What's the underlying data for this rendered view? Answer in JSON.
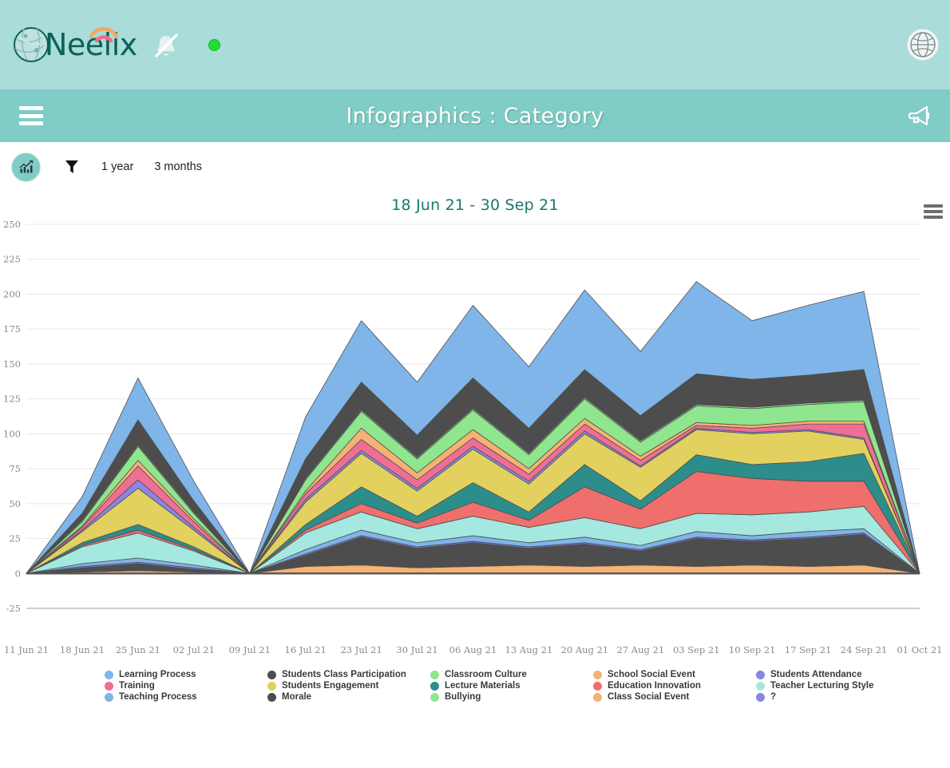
{
  "brand": {
    "name": "Neelix",
    "logo_icon": "globe-icon",
    "wifi_icon": "wifi-arc-icon",
    "bell_icon": "bell-muted-icon",
    "status_icon": "status-dot-online",
    "avatar_icon": "avatar-globe-icon"
  },
  "titlebar": {
    "menu_icon": "hamburger-menu-icon",
    "title": "Infographics : Category",
    "announce_icon": "megaphone-icon"
  },
  "toolbar": {
    "chart_icon": "bar-chart-icon",
    "filter_icon": "funnel-filter-icon",
    "range_1": "1 year",
    "range_2": "3 months"
  },
  "chart_card": {
    "heading": "18 Jun 21 - 30 Sep 21",
    "export_icon": "hamburger-export-icon"
  },
  "chart_data": {
    "type": "area",
    "stacked": true,
    "title": "18 Jun 21 - 30 Sep 21",
    "xlabel": "",
    "ylabel": "",
    "ylim": [
      -25,
      250
    ],
    "yticks": [
      -25,
      0,
      25,
      50,
      75,
      100,
      125,
      150,
      175,
      200,
      225,
      250
    ],
    "grid": true,
    "legend_position": "bottom",
    "x": [
      "11 Jun 21",
      "18 Jun 21",
      "25 Jun 21",
      "02 Jul 21",
      "09 Jul 21",
      "16 Jul 21",
      "23 Jul 21",
      "30 Jul 21",
      "06 Aug 21",
      "13 Aug 21",
      "20 Aug 21",
      "27 Aug 21",
      "03 Sep 21",
      "10 Sep 21",
      "17 Sep 21",
      "24 Sep 21",
      "01 Oct 21"
    ],
    "xticks": [
      "11 Jun 21",
      "18 Jun 21",
      "25 Jun 21",
      "02 Jul 21",
      "09 Jul 21",
      "16 Jul 21",
      "23 Jul 21",
      "30 Jul 21",
      "06 Aug 21",
      "13 Aug 21",
      "20 Aug 21",
      "27 Aug 21",
      "03 Sep 21",
      "10 Sep 21",
      "17 Sep 21",
      "24 Sep 21",
      "01 Oct 21"
    ],
    "series": [
      {
        "name": "Class Social Event",
        "color": "#f5b273",
        "values": [
          0,
          1,
          2,
          1,
          0,
          5,
          6,
          4,
          5,
          6,
          5,
          6,
          5,
          6,
          5,
          6,
          0
        ]
      },
      {
        "name": "Morale",
        "color": "#4d4d4d",
        "values": [
          0,
          3,
          5,
          2,
          0,
          8,
          20,
          14,
          17,
          12,
          16,
          10,
          20,
          17,
          20,
          22,
          0
        ]
      },
      {
        "name": "?",
        "color": "#7b77dd",
        "values": [
          0,
          1,
          1,
          1,
          0,
          1,
          1,
          1,
          1,
          1,
          1,
          1,
          1,
          1,
          1,
          1,
          0
        ]
      },
      {
        "name": "Teaching Process",
        "color": "#7fb5e8",
        "values": [
          0,
          2,
          3,
          2,
          0,
          3,
          4,
          3,
          4,
          3,
          4,
          3,
          4,
          3,
          4,
          3,
          0
        ]
      },
      {
        "name": "Teacher Lecturing Style",
        "color": "#a5e8e0",
        "values": [
          0,
          12,
          18,
          10,
          0,
          12,
          13,
          10,
          14,
          11,
          14,
          12,
          13,
          15,
          14,
          16,
          0
        ]
      },
      {
        "name": "Education Innovation",
        "color": "#ef6f6c",
        "values": [
          0,
          1,
          2,
          1,
          0,
          2,
          6,
          4,
          10,
          5,
          22,
          14,
          30,
          26,
          22,
          18,
          0
        ]
      },
      {
        "name": "Lecture Materials",
        "color": "#2d8d8a",
        "values": [
          0,
          2,
          4,
          2,
          0,
          4,
          12,
          5,
          14,
          6,
          16,
          6,
          12,
          10,
          14,
          20,
          0
        ]
      },
      {
        "name": "Students Engagement",
        "color": "#e2d15f",
        "values": [
          0,
          8,
          26,
          12,
          0,
          16,
          24,
          18,
          24,
          20,
          22,
          24,
          18,
          22,
          22,
          10,
          0
        ]
      },
      {
        "name": "Students Attendance",
        "color": "#8a86e3",
        "values": [
          0,
          1,
          6,
          2,
          0,
          2,
          2,
          2,
          2,
          2,
          2,
          1,
          1,
          1,
          1,
          1,
          0
        ]
      },
      {
        "name": "Training",
        "color": "#ef6f94",
        "values": [
          0,
          2,
          10,
          4,
          0,
          4,
          8,
          6,
          6,
          5,
          5,
          4,
          2,
          3,
          4,
          10,
          0
        ]
      },
      {
        "name": "School Social Event",
        "color": "#f5b273",
        "values": [
          0,
          1,
          4,
          2,
          0,
          2,
          8,
          5,
          6,
          4,
          4,
          3,
          2,
          2,
          2,
          2,
          0
        ]
      },
      {
        "name": "Classroom Culture",
        "color": "#90e58f",
        "values": [
          0,
          3,
          10,
          4,
          0,
          8,
          12,
          10,
          14,
          10,
          14,
          10,
          12,
          12,
          12,
          14,
          0
        ]
      },
      {
        "name": "Bullying",
        "color": "#90e58f",
        "values": [
          0,
          1,
          1,
          1,
          0,
          1,
          1,
          1,
          1,
          1,
          1,
          1,
          1,
          1,
          1,
          1,
          0
        ]
      },
      {
        "name": "Students Class Participation",
        "color": "#4d4d4d",
        "values": [
          0,
          5,
          18,
          8,
          0,
          14,
          20,
          16,
          22,
          18,
          20,
          18,
          22,
          20,
          20,
          22,
          0
        ]
      },
      {
        "name": "Learning Process",
        "color": "#7fb5e8",
        "values": [
          0,
          12,
          30,
          14,
          0,
          30,
          44,
          38,
          52,
          44,
          57,
          46,
          66,
          42,
          50,
          56,
          0
        ]
      }
    ]
  },
  "legend": {
    "items": [
      {
        "label": "Learning Process",
        "color": "#7fb5e8"
      },
      {
        "label": "Training",
        "color": "#ef6f94"
      },
      {
        "label": "Teaching Process",
        "color": "#7fb5e8"
      },
      {
        "label": "Students Class Participation",
        "color": "#4d4d4d"
      },
      {
        "label": "Students Engagement",
        "color": "#e2d15f"
      },
      {
        "label": "Morale",
        "color": "#4d4d4d"
      },
      {
        "label": "Classroom Culture",
        "color": "#90e58f"
      },
      {
        "label": "Lecture Materials",
        "color": "#2d8d8a"
      },
      {
        "label": "Bullying",
        "color": "#90e58f"
      },
      {
        "label": "School Social Event",
        "color": "#f5b273"
      },
      {
        "label": "Education Innovation",
        "color": "#ef6f6c"
      },
      {
        "label": "Class Social Event",
        "color": "#f5b273"
      },
      {
        "label": "Students Attendance",
        "color": "#8a86e3"
      },
      {
        "label": "Teacher Lecturing Style",
        "color": "#a5e8e0"
      },
      {
        "label": "?",
        "color": "#8a86e3"
      }
    ]
  },
  "colors": {
    "brand_bar": "#aadcd9",
    "title_bar": "#7fcdc6",
    "heading_text": "#18776c",
    "accent": "#7fcdc6"
  }
}
